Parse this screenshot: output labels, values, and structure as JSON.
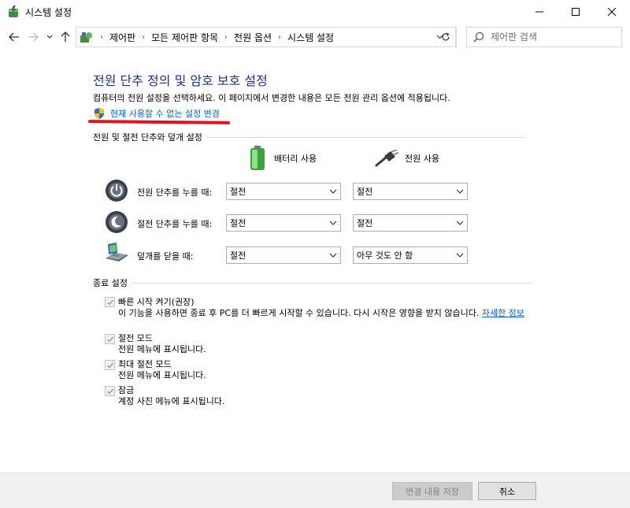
{
  "window": {
    "title": "시스템 설정"
  },
  "breadcrumb": [
    "제어판",
    "모든 제어판 항목",
    "전원 옵션",
    "시스템 설정"
  ],
  "search": {
    "placeholder": "제어판 검색"
  },
  "main": {
    "title": "전원 단추 정의 및 암호 보호 설정",
    "description": "컴퓨터의 전원 설정을 선택하세요. 이 페이지에서 변경한 내용은 모든 전원 관리 옵션에 적용됩니다.",
    "change_link": "현재 사용할 수 없는 설정 변경"
  },
  "buttons_section": {
    "label": "전원 및 절전 단추와 덮개 설정",
    "col_battery": "배터리 사용",
    "col_power": "전원 사용",
    "rows": [
      {
        "label": "전원 단추를 누를 때:",
        "battery": "절전",
        "power": "절전"
      },
      {
        "label": "절전 단추를 누를 때:",
        "battery": "절전",
        "power": "절전"
      },
      {
        "label": "덮개를 닫을 때:",
        "battery": "절전",
        "power": "아무 것도 안 함"
      }
    ]
  },
  "shutdown_section": {
    "label": "종료 설정",
    "options": [
      {
        "title": "빠른 시작 켜기(권장)",
        "desc": "이 기능을 사용하면 종료 후 PC를 더 빠르게 시작할 수 있습니다. 다시 시작은 영향을 받지 않습니다.",
        "link": "자세한 정보",
        "checked": true
      },
      {
        "title": "절전 모드",
        "desc": "전원 메뉴에 표시됩니다.",
        "checked": true
      },
      {
        "title": "최대 절전 모드",
        "desc": "전원 메뉴에 표시됩니다.",
        "checked": true
      },
      {
        "title": "잠금",
        "desc": "계정 사진 메뉴에 표시됩니다.",
        "checked": true
      }
    ]
  },
  "footer": {
    "save_label": "변경 내용 저장",
    "cancel_label": "취소"
  },
  "colors": {
    "title": "#1e3287",
    "link": "#0066cc",
    "annotation": "#e0141e"
  }
}
